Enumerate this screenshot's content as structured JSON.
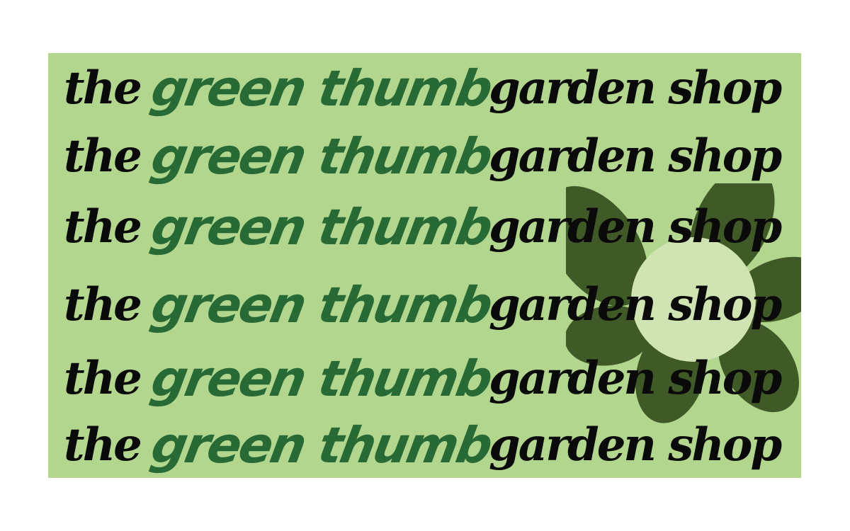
{
  "colors": {
    "background": "#b3d68e",
    "petal": "#3f5a27",
    "flower_center": "#cfe4b2",
    "green_text": "#286a35",
    "dark_text": "#0a0a0a"
  },
  "icons": {
    "flower": "flower-icon"
  },
  "rows": [
    {
      "the": "the",
      "green_thumb": "green thumb",
      "garden_shop": "garden shop"
    },
    {
      "the": "the",
      "green_thumb": "green thumb",
      "garden_shop": "garden shop"
    },
    {
      "the": "the",
      "green_thumb": "green thumb",
      "garden_shop": "garden shop"
    },
    {
      "the": "the",
      "green_thumb": "green thumb",
      "garden_shop": "garden shop"
    },
    {
      "the": "the",
      "green_thumb": "green thumb",
      "garden_shop": "garden shop"
    },
    {
      "the": "the",
      "green_thumb": "green thumb",
      "garden_shop": "garden shop"
    }
  ]
}
